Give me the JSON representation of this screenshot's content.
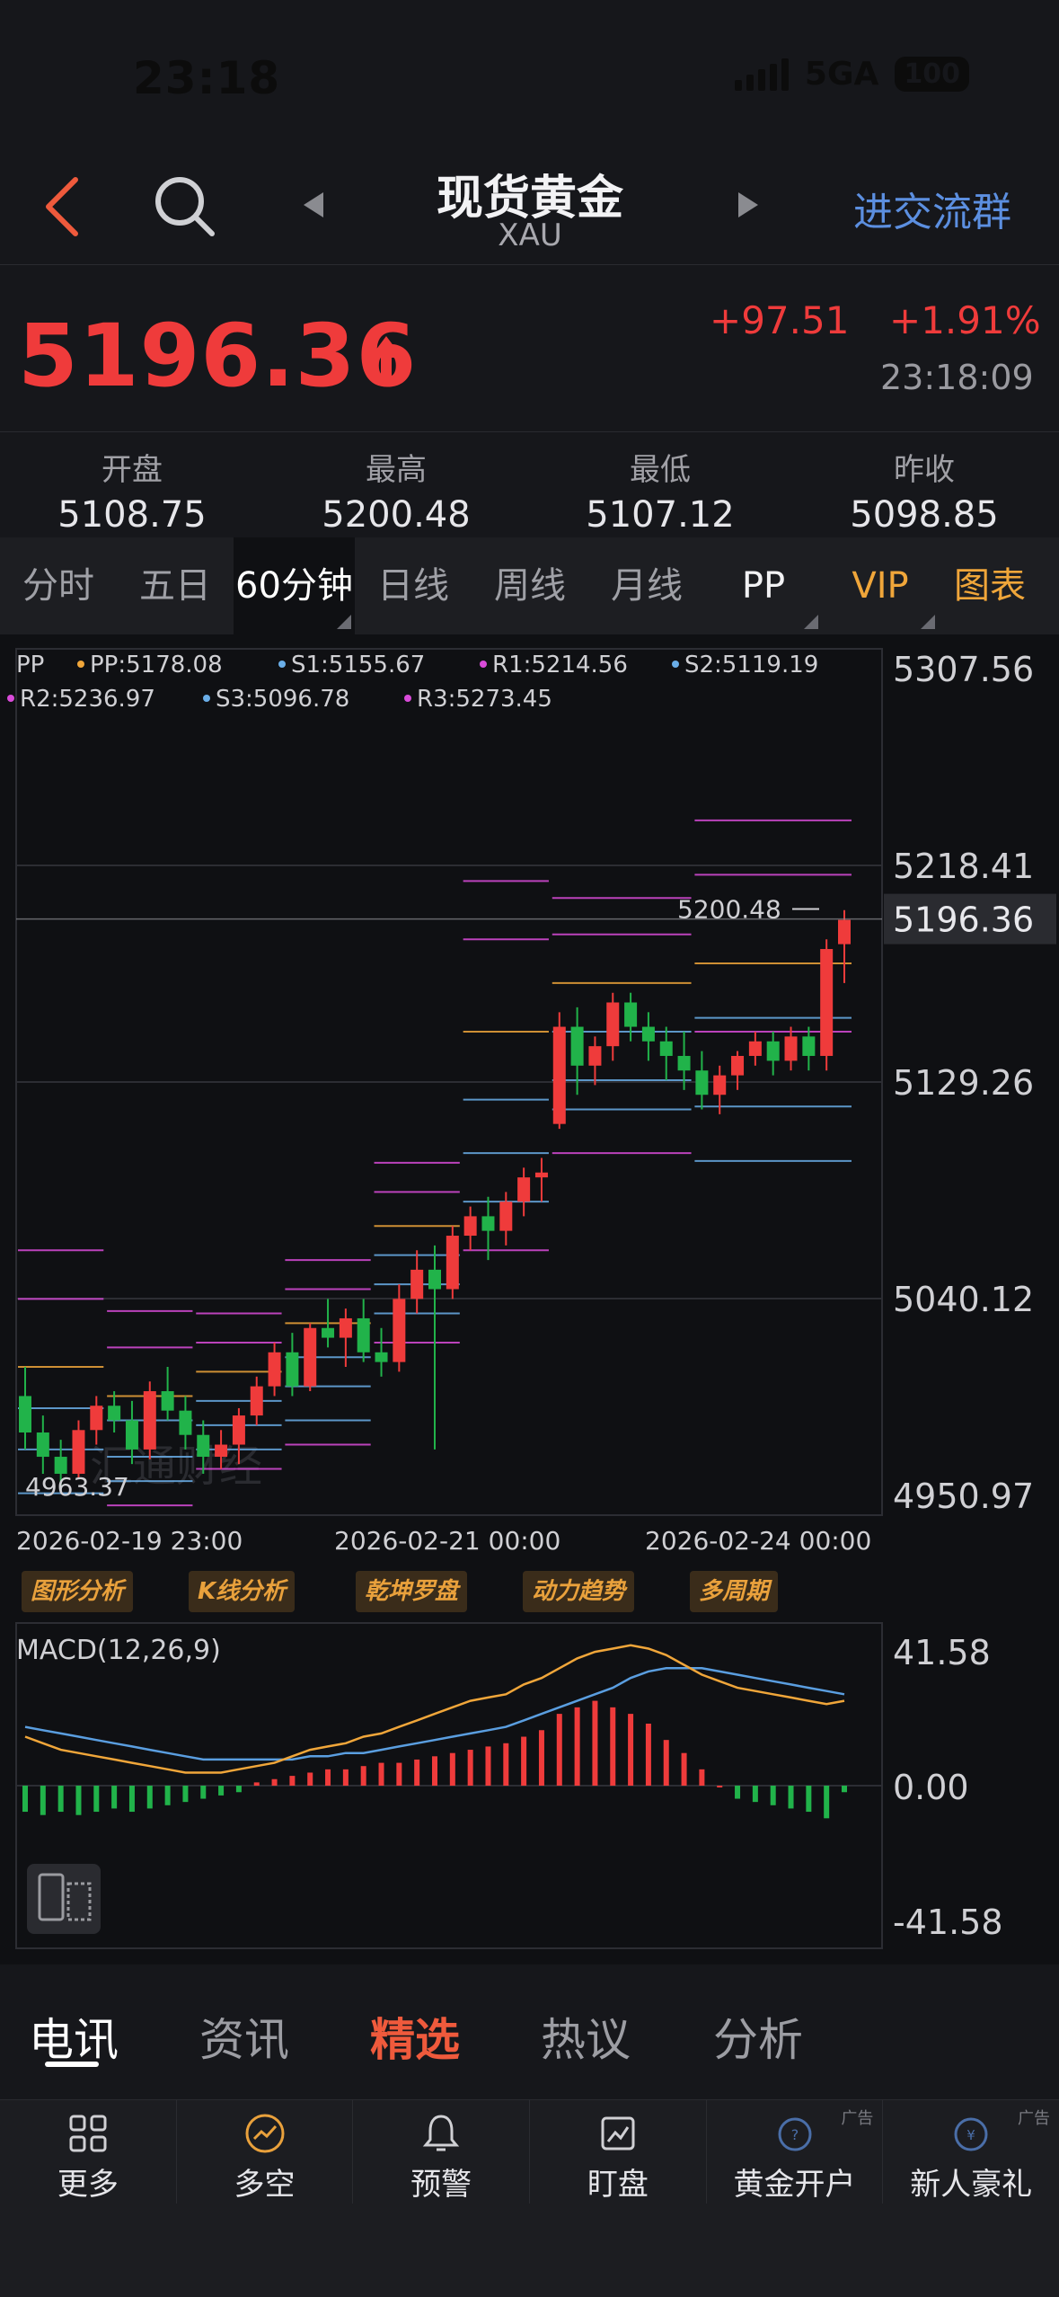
{
  "status": {
    "time": "23:18",
    "network": "5GA",
    "battery": "100"
  },
  "header": {
    "title": "现货黄金",
    "subtitle": "XAU",
    "group_link": "进交流群"
  },
  "quote": {
    "price": "5196.36",
    "change": "+97.51",
    "change_pct": "+1.91%",
    "time": "23:18:09",
    "up_color": "#ef3b3b",
    "down_color": "#21b34a"
  },
  "stats": [
    {
      "label": "开盘",
      "value": "5108.75"
    },
    {
      "label": "最高",
      "value": "5200.48"
    },
    {
      "label": "最低",
      "value": "5107.12"
    },
    {
      "label": "昨收",
      "value": "5098.85"
    }
  ],
  "tabs": [
    "分时",
    "五日",
    "60分钟",
    "日线",
    "周线",
    "月线",
    "PP",
    "VIP",
    "图表"
  ],
  "active_tab": "60分钟",
  "chart_data": [
    {
      "type": "candlestick",
      "indicator": "PP",
      "legend": [
        {
          "text": "PP:5178.08",
          "color": "#f0a63a"
        },
        {
          "text": "S1:5155.67",
          "color": "#6aaee8"
        },
        {
          "text": "R1:5214.56",
          "color": "#d94bd9"
        },
        {
          "text": "S2:5119.19",
          "color": "#6aaee8"
        },
        {
          "text": "R2:5236.97",
          "color": "#d94bd9"
        },
        {
          "text": "S3:5096.78",
          "color": "#6aaee8"
        },
        {
          "text": "R3:5273.45",
          "color": "#d94bd9"
        }
      ],
      "legend_title": "PP",
      "y_ticks": [
        "5307.56",
        "5218.41",
        "5129.26",
        "5040.12",
        "4950.97"
      ],
      "ylim": [
        4950.97,
        5307.56
      ],
      "x_ticks": [
        "2026-02-19 23:00",
        "2026-02-21 00:00",
        "2026-02-24 00:00"
      ],
      "current_price_label": "5196.36",
      "high_label": "5200.48",
      "low_label": "4963.37",
      "candles": [
        [
          5000,
          5012,
          4978,
          4985
        ],
        [
          4985,
          4992,
          4968,
          4975
        ],
        [
          4975,
          4982,
          4962,
          4968
        ],
        [
          4968,
          4990,
          4966,
          4986
        ],
        [
          4986,
          5000,
          4980,
          4996
        ],
        [
          4996,
          5002,
          4985,
          4990
        ],
        [
          4990,
          4998,
          4972,
          4978
        ],
        [
          4978,
          5006,
          4974,
          5002
        ],
        [
          5002,
          5012,
          4990,
          4994
        ],
        [
          4994,
          5000,
          4978,
          4984
        ],
        [
          4984,
          4990,
          4968,
          4975
        ],
        [
          4975,
          4986,
          4970,
          4980
        ],
        [
          4980,
          4995,
          4972,
          4992
        ],
        [
          4992,
          5008,
          4988,
          5004
        ],
        [
          5004,
          5022,
          5000,
          5018
        ],
        [
          5018,
          5026,
          5000,
          5004
        ],
        [
          5004,
          5030,
          5002,
          5028
        ],
        [
          5028,
          5040,
          5020,
          5024
        ],
        [
          5024,
          5036,
          5012,
          5032
        ],
        [
          5032,
          5040,
          5014,
          5018
        ],
        [
          5018,
          5028,
          5008,
          5014
        ],
        [
          5014,
          5046,
          5010,
          5040
        ],
        [
          5040,
          5060,
          5034,
          5052
        ],
        [
          5052,
          5062,
          4978,
          5044
        ],
        [
          5044,
          5070,
          5040,
          5066
        ],
        [
          5066,
          5078,
          5060,
          5074
        ],
        [
          5074,
          5082,
          5056,
          5068
        ],
        [
          5068,
          5084,
          5062,
          5080
        ],
        [
          5080,
          5094,
          5074,
          5090
        ],
        [
          5090,
          5098,
          5080,
          5092
        ],
        [
          5112,
          5158,
          5110,
          5152
        ],
        [
          5152,
          5160,
          5124,
          5136
        ],
        [
          5136,
          5148,
          5128,
          5144
        ],
        [
          5144,
          5166,
          5138,
          5162
        ],
        [
          5162,
          5166,
          5146,
          5152
        ],
        [
          5152,
          5158,
          5138,
          5146
        ],
        [
          5146,
          5152,
          5130,
          5140
        ],
        [
          5140,
          5150,
          5126,
          5134
        ],
        [
          5134,
          5142,
          5118,
          5124
        ],
        [
          5124,
          5136,
          5116,
          5132
        ],
        [
          5132,
          5142,
          5126,
          5140
        ],
        [
          5140,
          5150,
          5136,
          5146
        ],
        [
          5146,
          5150,
          5132,
          5138
        ],
        [
          5138,
          5152,
          5134,
          5148
        ],
        [
          5148,
          5152,
          5134,
          5140
        ],
        [
          5140,
          5188,
          5134,
          5184
        ],
        [
          5186,
          5200,
          5170,
          5196
        ]
      ]
    },
    {
      "type": "bar",
      "indicator": "MACD",
      "title": "MACD(12,26,9)",
      "y_ticks": [
        "41.58",
        "0.00",
        "-41.58"
      ],
      "ylim": [
        -41.58,
        41.58
      ],
      "histogram": [
        -8,
        -9,
        -8,
        -9,
        -8,
        -7,
        -8,
        -7,
        -6,
        -5,
        -4,
        -3,
        -2,
        1,
        2,
        3,
        4,
        5,
        5,
        6,
        7,
        7,
        8,
        9,
        10,
        11,
        12,
        13,
        15,
        17,
        22,
        24,
        26,
        24,
        22,
        19,
        14,
        10,
        5,
        0,
        -4,
        -5,
        -6,
        -7,
        -8,
        -10,
        -2
      ],
      "dif": [
        15,
        13,
        11,
        10,
        9,
        8,
        7,
        6,
        5,
        4,
        4,
        4,
        5,
        6,
        7,
        9,
        11,
        12,
        13,
        15,
        16,
        18,
        20,
        22,
        24,
        26,
        27,
        28,
        31,
        33,
        36,
        39,
        41,
        42,
        43,
        42,
        40,
        37,
        34,
        32,
        30,
        29,
        28,
        27,
        26,
        25,
        26
      ],
      "dea": [
        18,
        17,
        16,
        15,
        14,
        13,
        12,
        11,
        10,
        9,
        8,
        8,
        8,
        8,
        8,
        8,
        9,
        9,
        10,
        10,
        11,
        12,
        13,
        14,
        15,
        16,
        17,
        18,
        20,
        22,
        24,
        26,
        28,
        30,
        33,
        35,
        36,
        36,
        36,
        35,
        34,
        33,
        32,
        31,
        30,
        29,
        28
      ]
    }
  ],
  "tools": [
    "图形分析",
    "K线分析",
    "乾坤罗盘",
    "动力趋势",
    "多周期"
  ],
  "news_tabs": [
    "电讯",
    "资讯",
    "精选",
    "热议",
    "分析"
  ],
  "bottom_bar": [
    {
      "label": "更多",
      "icon": "grid-icon",
      "ad": ""
    },
    {
      "label": "多空",
      "icon": "trend-icon",
      "ad": ""
    },
    {
      "label": "预警",
      "icon": "bell-icon",
      "ad": ""
    },
    {
      "label": "盯盘",
      "icon": "watch-chart-icon",
      "ad": ""
    },
    {
      "label": "黄金开户",
      "icon": "account-icon",
      "ad": "广告"
    },
    {
      "label": "新人豪礼",
      "icon": "gift-icon",
      "ad": "广告"
    }
  ],
  "watermark": "汇通财经"
}
